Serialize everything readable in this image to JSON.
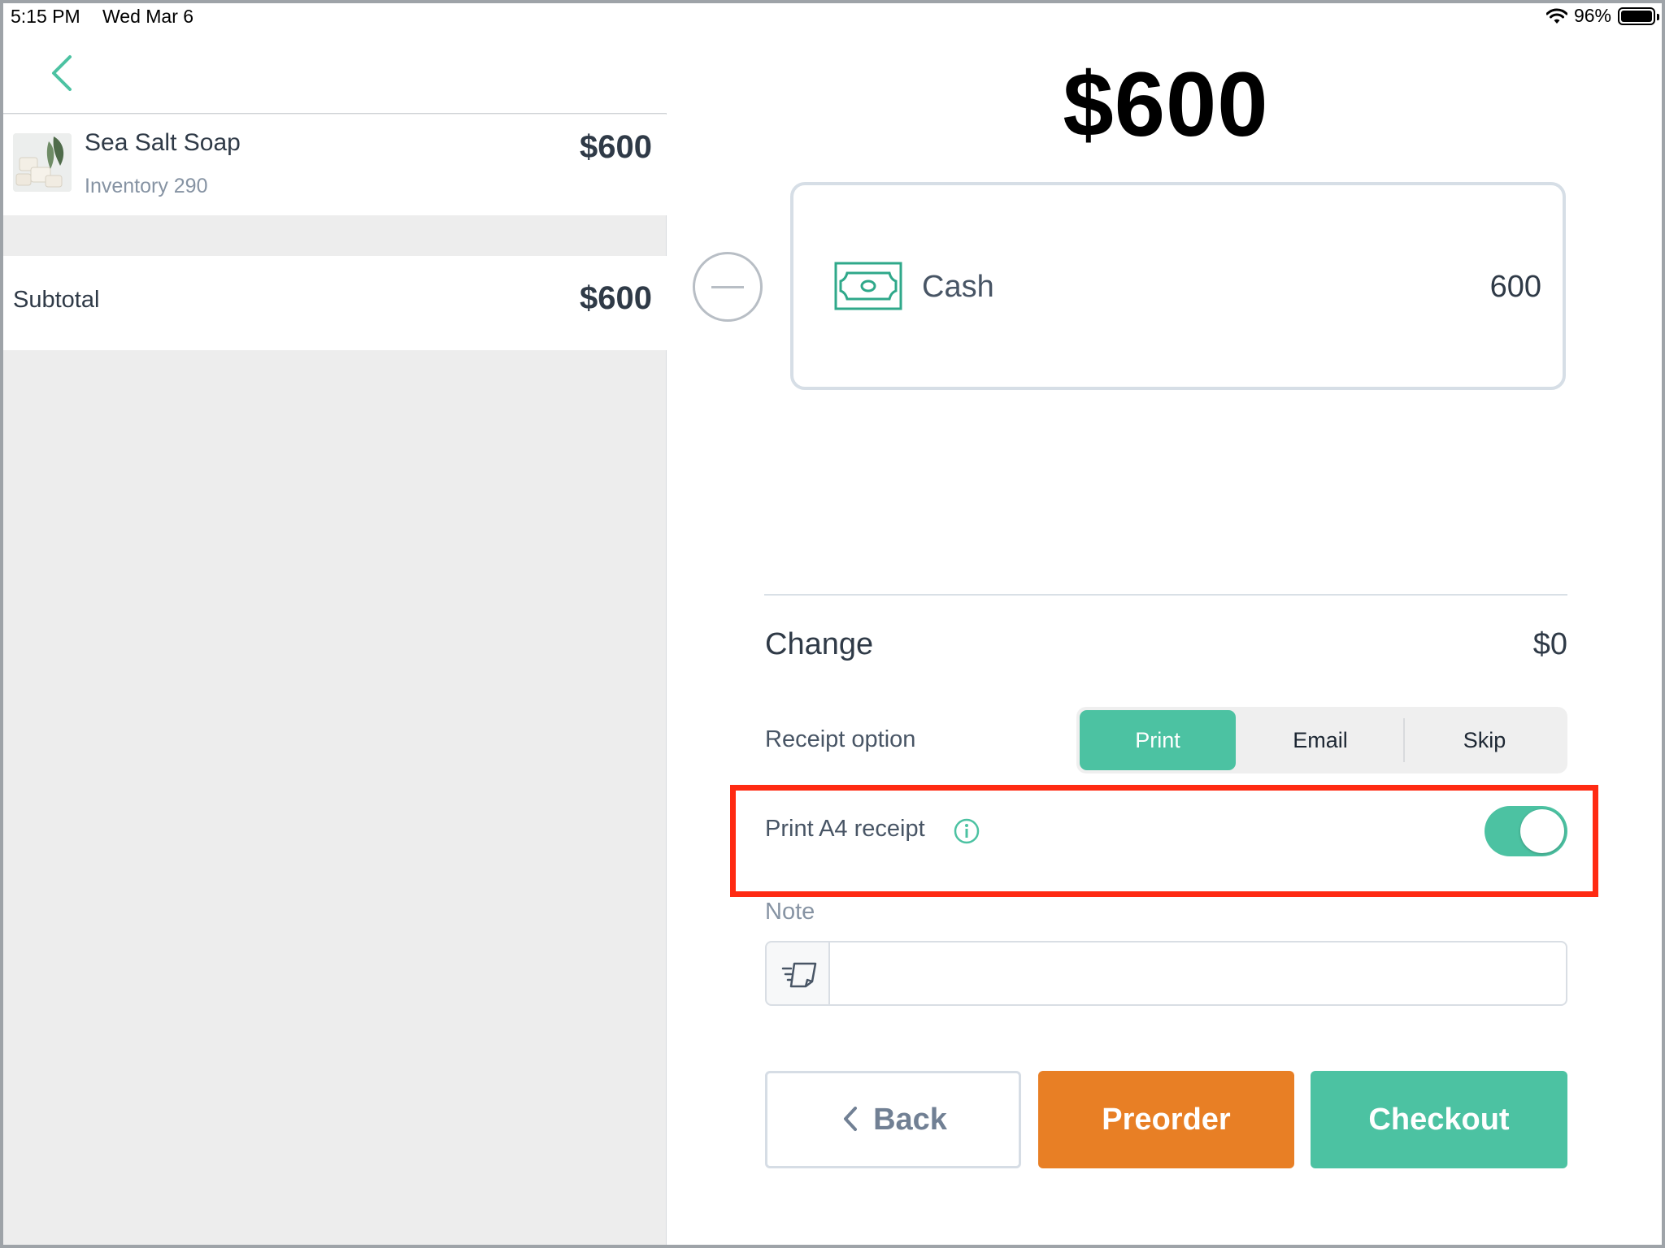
{
  "status_bar": {
    "time": "5:15 PM",
    "date": "Wed Mar 6",
    "battery": "96%",
    "wifi_icon": "wifi-icon",
    "battery_icon": "battery-icon"
  },
  "cart": {
    "back_icon": "chevron-left-icon",
    "items": [
      {
        "name": "Sea Salt Soap",
        "inventory": "Inventory 290",
        "price": "$600",
        "thumbnail": "product-thumbnail"
      }
    ],
    "subtotal_label": "Subtotal",
    "subtotal_value": "$600"
  },
  "payment": {
    "total": "$600",
    "remove_icon": "minus-circle-icon",
    "methods": [
      {
        "label": "Cash",
        "amount": "600",
        "icon": "cash-icon"
      }
    ],
    "change_label": "Change",
    "change_value": "$0",
    "receipt_option_label": "Receipt option",
    "receipt_options": [
      "Print",
      "Email",
      "Skip"
    ],
    "receipt_selected": "Print",
    "print_a4_label": "Print A4 receipt",
    "print_a4_enabled": true,
    "note_label": "Note",
    "note_value": ""
  },
  "actions": {
    "back": "Back",
    "preorder": "Preorder",
    "checkout": "Checkout"
  },
  "colors": {
    "accent": "#4cc2a2",
    "preorder": "#e87f25",
    "highlight": "#ff2a12",
    "text": "#2f3a47"
  }
}
